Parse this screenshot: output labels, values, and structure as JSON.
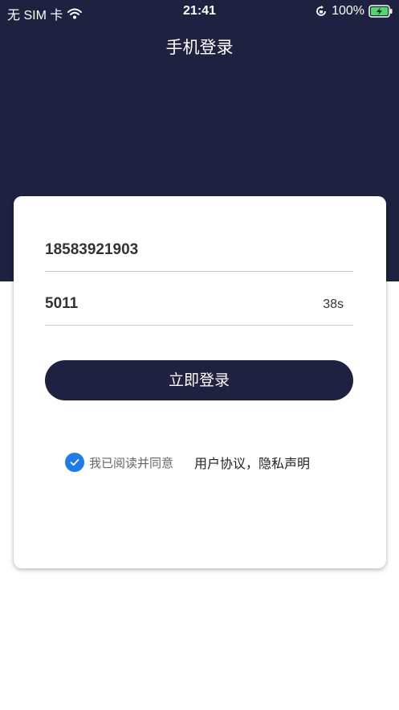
{
  "status_bar": {
    "carrier": "无 SIM 卡",
    "time": "21:41",
    "battery": "100%"
  },
  "header": {
    "title": "手机登录"
  },
  "form": {
    "phone_value": "18583921903",
    "code_value": "5011",
    "countdown": "38s",
    "login_label": "立即登录"
  },
  "agreement": {
    "checked": true,
    "prefix": "我已阅读并同意",
    "links": "用户协议，隐私声明"
  },
  "colors": {
    "header_bg": "#1f2140",
    "accent": "#1e7be8",
    "button_bg": "#1f2140"
  },
  "icons": {
    "wifi": "wifi-icon",
    "orientation_lock": "orientation-lock-icon",
    "battery": "battery-charging-icon",
    "checkbox": "check-icon"
  }
}
